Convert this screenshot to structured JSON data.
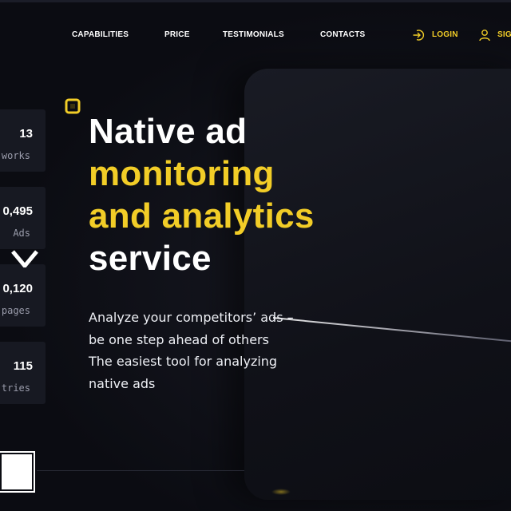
{
  "nav": {
    "items": [
      {
        "label": "CAPABILITIES"
      },
      {
        "label": "PRICE"
      },
      {
        "label": "TESTIMONIALS"
      },
      {
        "label": "CONTACTS"
      }
    ],
    "login_label": "LOGIN",
    "signup_label": "SIG",
    "login_icon": "login-arrow-icon",
    "signup_icon": "user-icon"
  },
  "stats": [
    {
      "value": "13",
      "label": "works"
    },
    {
      "value": "0,495",
      "label": "Ads"
    },
    {
      "value": "0,120",
      "label": "pages"
    },
    {
      "value": "115",
      "label": "tries"
    }
  ],
  "hero": {
    "line1": "Native ad",
    "line2": "monitoring",
    "line3": "and analytics",
    "line4": "service",
    "subtitle": [
      "Analyze your competitors’ ads –",
      "be one step ahead of others",
      "The easiest tool for analyzing",
      "native ads"
    ]
  },
  "colors": {
    "accent": "#f2cd27",
    "background": "#0b0c12",
    "card": "#171922"
  }
}
